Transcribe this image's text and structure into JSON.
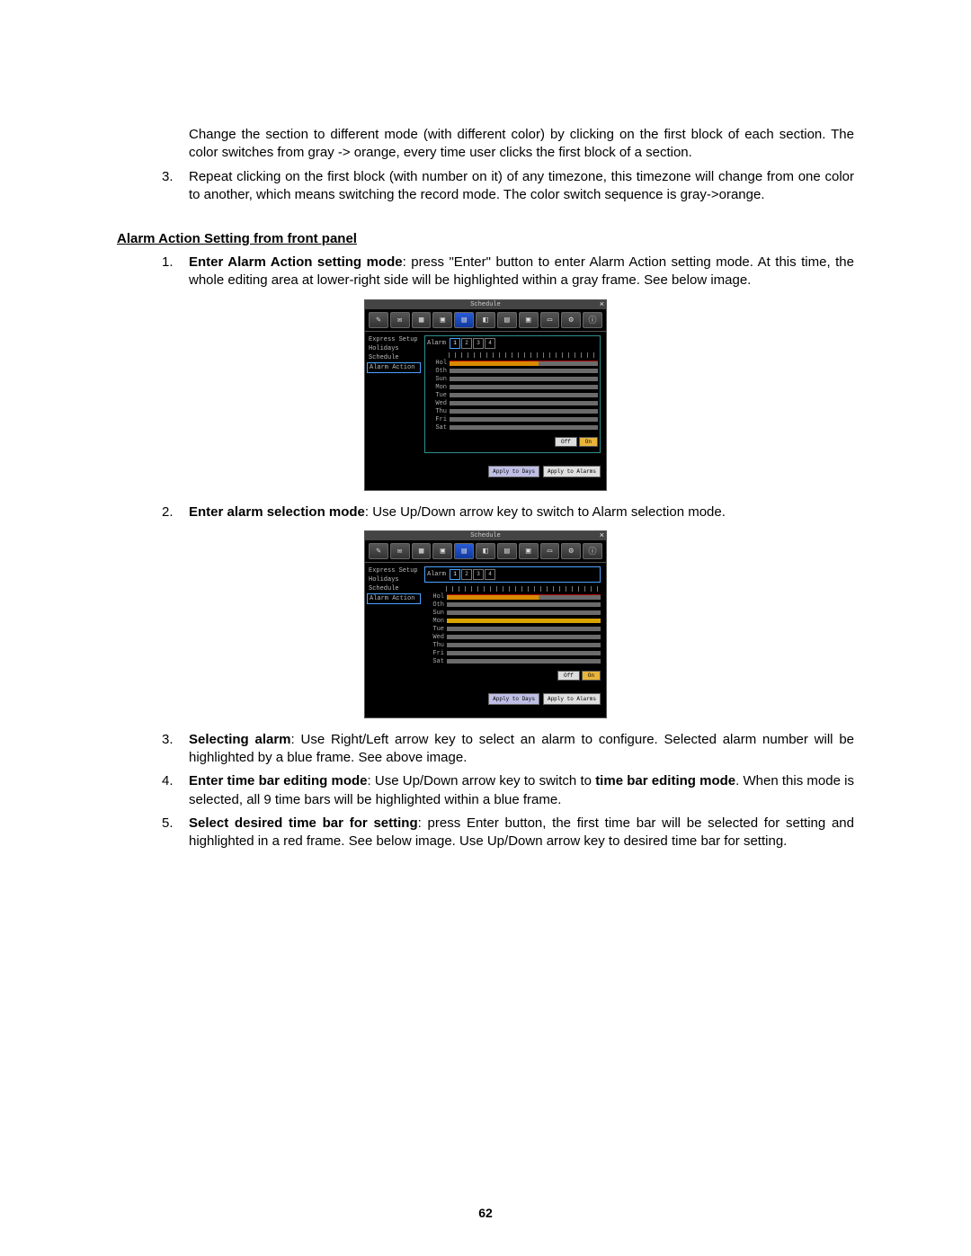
{
  "intro_item_text": "Change the section to different mode (with different color) by clicking on the first block of each section. The color switches from gray -> orange, every time user clicks the first block of a section.",
  "top_list": {
    "num3": "3.",
    "text3": "Repeat clicking on the first block (with number on it) of any timezone, this timezone will change from one color to another, which means switching the record mode. The color switch sequence is gray->orange."
  },
  "section_title": "Alarm Action Setting from front panel",
  "steps": {
    "n1": "1.",
    "t1_bold": "Enter Alarm Action setting mode",
    "t1_rest": ": press \"Enter\" button to enter Alarm Action setting mode. At this time, the whole editing area at lower-right side will be highlighted within a gray frame. See below image.",
    "n2": "2.",
    "t2_bold": "Enter alarm selection mode",
    "t2_rest": ": Use Up/Down arrow key to switch to Alarm selection mode.",
    "n3": "3.",
    "t3_bold": "Selecting alarm",
    "t3_rest": ": Use Right/Left arrow key to select an alarm to configure. Selected alarm number will be highlighted by a blue frame. See above image.",
    "n4": "4.",
    "t4_bold": "Enter time bar editing mode",
    "t4_rest_a": ": Use Up/Down arrow key to switch to ",
    "t4_bold_b": "time bar editing mode",
    "t4_rest_b": ". When this mode is selected, all 9 time bars will be highlighted within a blue frame.",
    "n5": "5.",
    "t5_bold": "Select desired time bar for setting",
    "t5_rest": ": press Enter button, the first time bar will be selected for setting and highlighted in a red frame. See below image. Use Up/Down arrow key to desired time bar for setting."
  },
  "dvr": {
    "title": "Schedule",
    "close": "×",
    "side": {
      "i0": "Express Setup",
      "i1": "Holidays",
      "i2": "Schedule",
      "i3": "Alarm Action"
    },
    "alarm_label": "Alarm",
    "alarm_nums": {
      "a1": "1",
      "a2": "2",
      "a3": "3",
      "a4": "4"
    },
    "days": {
      "d0": "Hol",
      "d1": "Oth",
      "d2": "Sun",
      "d3": "Mon",
      "d4": "Tue",
      "d5": "Wed",
      "d6": "Thu",
      "d7": "Fri",
      "d8": "Sat"
    },
    "off": "Off",
    "on": "On",
    "apply_days": "Apply to Days",
    "apply_alarms": "Apply to Alarms"
  },
  "page_number": "62"
}
